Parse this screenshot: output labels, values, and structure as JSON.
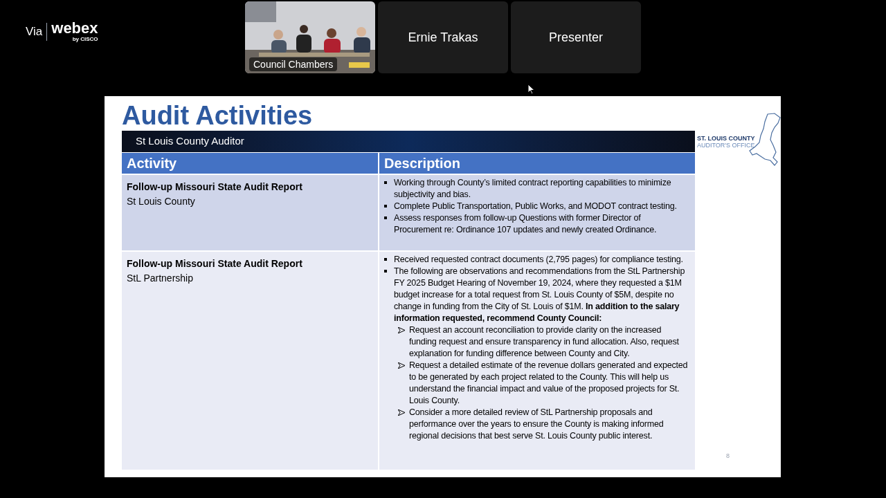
{
  "branding": {
    "via": "Via",
    "logo": "webex",
    "logo_sub": "by CISCO"
  },
  "video_tiles": [
    {
      "kind": "video",
      "label": "Council Chambers"
    },
    {
      "kind": "name",
      "label": "Ernie Trakas"
    },
    {
      "kind": "name",
      "label": "Presenter"
    }
  ],
  "slide": {
    "title": "Audit Activities",
    "banner": "St Louis County Auditor",
    "logo_line1": "ST. LOUIS COUNTY",
    "logo_line2": "AUDITOR'S OFFICE",
    "columns": [
      "Activity",
      "Description"
    ],
    "rows": [
      {
        "activity": "Follow-up Missouri State Audit Report",
        "entity": "St Louis County",
        "items": [
          {
            "kind": "bullet",
            "text": "Working through County’s limited contract reporting capabilities to minimize subjectivity and bias."
          },
          {
            "kind": "bullet",
            "text": "Complete Public Transportation, Public Works, and MODOT contract testing."
          },
          {
            "kind": "bullet",
            "text": "Assess responses from follow-up Questions with former Director of Procurement re: Ordinance 107 updates and newly created Ordinance."
          }
        ]
      },
      {
        "activity": "Follow-up Missouri State Audit Report",
        "entity": "StL Partnership",
        "items": [
          {
            "kind": "bullet",
            "text": "Received requested contract documents (2,795 pages) for compliance testing."
          },
          {
            "kind": "bullet",
            "text": "The following are observations and recommendations from the StL Partnership FY 2025 Budget Hearing of November 19, 2024, where they requested a $1M budget increase for a total request from St. Louis County of $5M, despite no change in funding from the City of St. Louis of $1M. **In addition to the salary information requested, recommend County Council:**"
          },
          {
            "kind": "arrow",
            "text": "Request an account reconciliation to provide clarity on the increased funding request and ensure transparency in fund allocation. Also, request explanation for funding difference between County and City."
          },
          {
            "kind": "arrow",
            "text": "Request a detailed estimate of the revenue dollars generated and expected to be generated by each project related to the County. This will help us understand the financial impact and value of the proposed projects for St. Louis County."
          },
          {
            "kind": "arrow",
            "text": "Consider a more detailed review of StL Partnership proposals and performance over the years to ensure the County is making informed regional decisions that best serve St. Louis County public interest."
          }
        ]
      }
    ],
    "page_number": "8"
  }
}
